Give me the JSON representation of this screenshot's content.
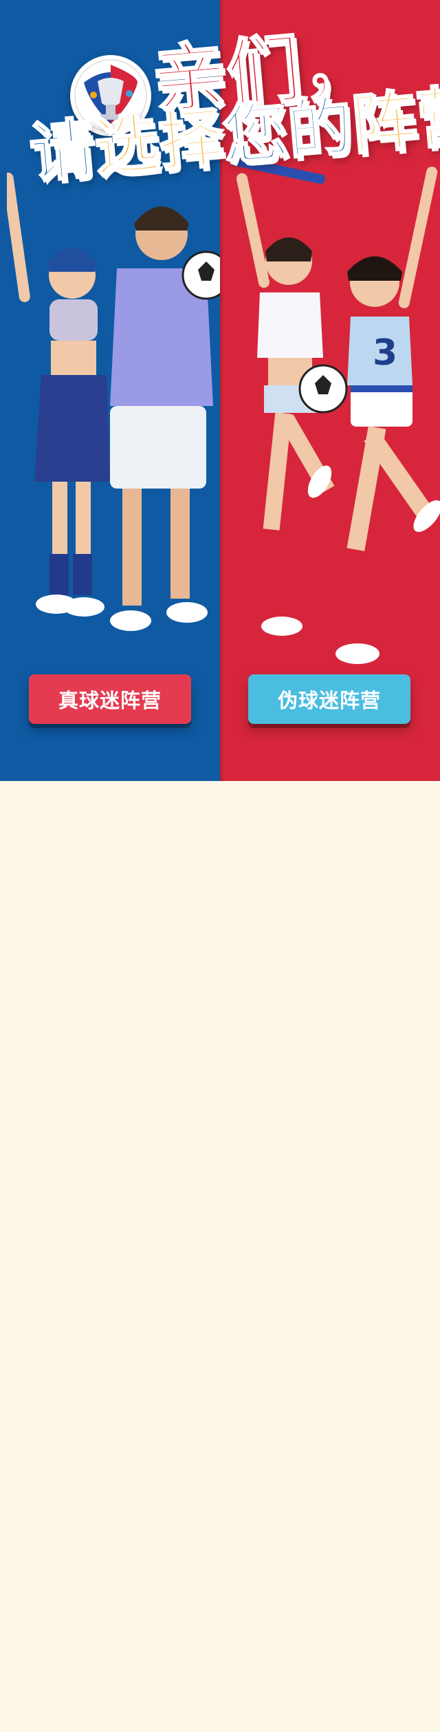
{
  "headline": {
    "line1": "亲们，",
    "line2_prefix": "请",
    "line2_accent1": "选择",
    "line2_middle": "您的",
    "line2_accent2": "阵营！"
  },
  "icons": {
    "logo": "euro-cup-trophy-logo",
    "left_photo": "fans-couple-photo",
    "right_photo": "fans-girls-photo"
  },
  "camps": {
    "true_fan_label": "真球迷阵营",
    "fake_fan_label": "伪球迷阵营"
  },
  "colors": {
    "left_panel": "#0f5aa3",
    "right_panel": "#d7263b",
    "accent_yellow": "#f4a81a",
    "true_fan_button": "#e43b51",
    "fake_fan_button": "#4bbde1",
    "page_background": "#fdf7ea"
  }
}
